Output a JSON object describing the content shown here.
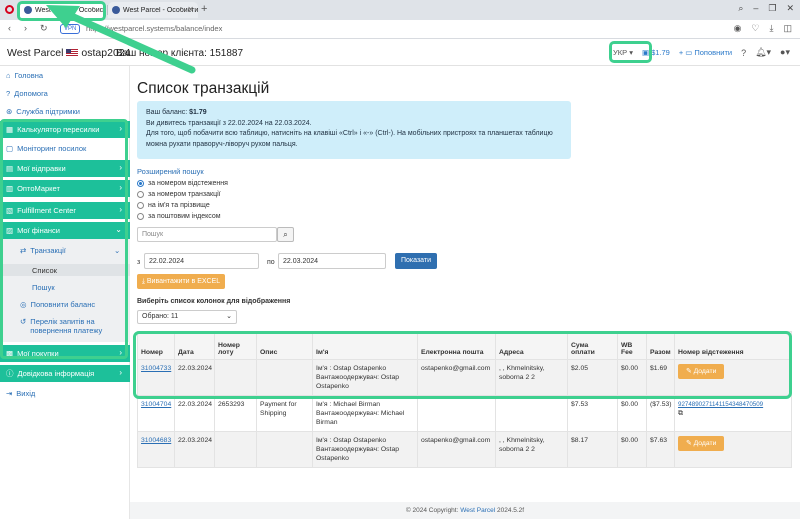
{
  "browser": {
    "tabs": [
      {
        "label": "West Parcel - Особистий"
      },
      {
        "label": "West Parcel - Особистий"
      }
    ],
    "vpn_label": "VPN",
    "url": "https://westparcel.systems/balance/index"
  },
  "navbar": {
    "brand": "West Parcel",
    "username": "ostap2024",
    "client_number": "Ваш номер клієнта: 151887",
    "lang": "УКР",
    "balance": "$1.79",
    "topup": "Поповнити"
  },
  "sidebar": {
    "items": [
      {
        "label": "Головна"
      },
      {
        "label": "Допомога"
      },
      {
        "label": "Служба підтримки"
      },
      {
        "label": "Калькулятор пересилки"
      },
      {
        "label": "Моніторинг посилок"
      },
      {
        "label": "Мої відправки"
      },
      {
        "label": "ОптоМаркет"
      },
      {
        "label": "Fulfillment Center"
      },
      {
        "label": "Мої фінанси"
      },
      {
        "label": "Транзакції"
      },
      {
        "label": "Список"
      },
      {
        "label": "Пошук"
      },
      {
        "label": "Поповнити баланс"
      },
      {
        "label": "Перелік запитів на повернення платежу"
      },
      {
        "label": "Мої покупки"
      },
      {
        "label": "Довідкова інформація"
      },
      {
        "label": "Вихід"
      }
    ]
  },
  "page": {
    "title": "Список транзакцій",
    "info": {
      "balance_label": "Ваш баланс:",
      "balance_value": "$1.79",
      "period": "Ви дивитесь транзакції з 22.02.2024 на 22.03.2024.",
      "hint": "Для того, щоб побачити всю таблицю, натисніть на клавіші «Ctrl» і «-» (Ctrl-). На мобільних пристроях та планшетах таблицю можна рухати праворуч-ліворуч рухом пальця."
    },
    "advanced_search": "Розширений пошук",
    "radios": [
      {
        "label": "за номером відстеження",
        "checked": true
      },
      {
        "label": "за номером транзакції",
        "checked": false
      },
      {
        "label": "на ім'я та прізвище",
        "checked": false
      },
      {
        "label": "за поштовим індексом",
        "checked": false
      }
    ],
    "search_placeholder": "Пошук",
    "from_label": "з",
    "from_date": "22.02.2024",
    "to_label": "по",
    "to_date": "22.03.2024",
    "show_button": "Показати",
    "excel_button": "Вивантажити в EXCEL",
    "columns_label": "Виберіть список колонок для відображення",
    "columns_selected": "Обрано: 11"
  },
  "table": {
    "headers": [
      "Номер",
      "Дата",
      "Номер лоту",
      "Опис",
      "Ім'я",
      "Електронна пошта",
      "Адреса",
      "Сума оплати",
      "WB Fee",
      "Разом",
      "Номер відстеження"
    ],
    "rows": [
      {
        "number": "31004733",
        "date": "22.03.2024",
        "lot": "",
        "desc": "",
        "name": "Ім'я : Ostap Ostapenko Вантажоодержувач: Ostap Ostapenko",
        "email": "ostapenko@gmail.com",
        "address": ", , Khmelnitsky, soborna 2 2",
        "amount": "$2.05",
        "fee": "$0.00",
        "total": "$1.69",
        "total_negative": false,
        "tracking": "",
        "action": "Додати"
      },
      {
        "number": "31004704",
        "date": "22.03.2024",
        "lot": "2653293",
        "desc": "Payment for Shipping",
        "name": "Ім'я : Michael Birman Вантажоодержувач: Michael Birman",
        "email": "",
        "address": "",
        "amount": "$7.53",
        "fee": "$0.00",
        "total": "($7.53)",
        "total_negative": true,
        "tracking": "9274890271141154348470509",
        "action": ""
      },
      {
        "number": "31004683",
        "date": "22.03.2024",
        "lot": "",
        "desc": "",
        "name": "Ім'я : Ostap Ostapenko Вантажоодержувач: Ostap Ostapenko",
        "email": "ostapenko@gmail.com",
        "address": ", , Khmelnitsky, soborna 2 2",
        "amount": "$8.17",
        "fee": "$0.00",
        "total": "$7.63",
        "total_negative": false,
        "tracking": "",
        "action": "Додати"
      }
    ]
  },
  "footer": {
    "text": "© 2024 Copyright:",
    "link": "West Parcel",
    "version": "2024.5.2f"
  },
  "colors": {
    "accent_green": "#1dc09a",
    "highlight": "#3ed08f",
    "link_blue": "#2a6fb5",
    "warning_orange": "#f0ad4e"
  }
}
